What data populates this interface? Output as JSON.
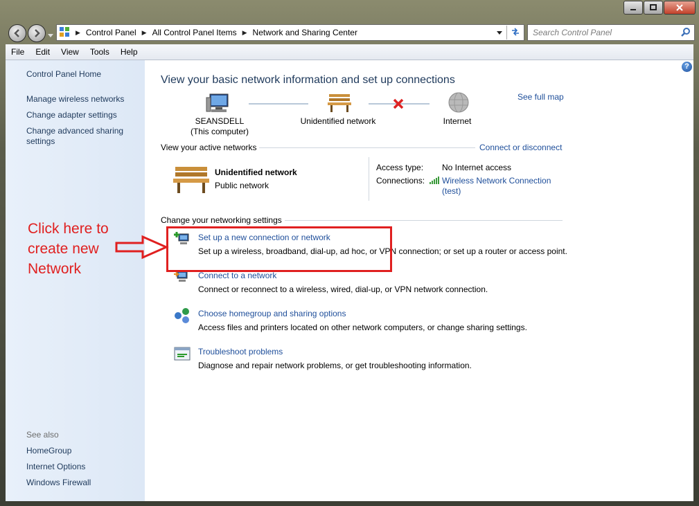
{
  "titlebar": {
    "minimize_icon": "minimize-icon",
    "maximize_icon": "maximize-icon",
    "close_icon": "close-icon"
  },
  "breadcrumb": {
    "items": [
      "Control Panel",
      "All Control Panel Items",
      "Network and Sharing Center"
    ]
  },
  "search": {
    "placeholder": "Search Control Panel"
  },
  "menu": {
    "items": [
      "File",
      "Edit",
      "View",
      "Tools",
      "Help"
    ]
  },
  "sidebar": {
    "home": "Control Panel Home",
    "links": [
      "Manage wireless networks",
      "Change adapter settings",
      "Change advanced sharing",
      "settings"
    ],
    "see_also_heading": "See also",
    "see_also": [
      "HomeGroup",
      "Internet Options",
      "Windows Firewall"
    ]
  },
  "main": {
    "heading": "View your basic network information and set up connections",
    "see_full_map": "See full map",
    "map": {
      "computer_name": "SEANSDELL",
      "computer_sub": "(This computer)",
      "network": "Unidentified network",
      "internet": "Internet"
    },
    "active_networks_label": "View your active networks",
    "connect_disconnect": "Connect or disconnect",
    "active": {
      "name": "Unidentified network",
      "type": "Public network",
      "access_type_label": "Access type:",
      "access_type_value": "No Internet access",
      "connections_label": "Connections:",
      "connection_link_1": "Wireless Network Connection",
      "connection_link_2": "(test)"
    },
    "change_settings_label": "Change your networking settings",
    "tasks": [
      {
        "title": "Set up a new connection or network",
        "desc": "Set up a wireless, broadband, dial-up, ad hoc, or VPN connection; or set up a router or access point."
      },
      {
        "title": "Connect to a network",
        "desc": "Connect or reconnect to a wireless, wired, dial-up, or VPN network connection."
      },
      {
        "title": "Choose homegroup and sharing options",
        "desc": "Access files and printers located on other network computers, or change sharing settings."
      },
      {
        "title": "Troubleshoot problems",
        "desc": "Diagnose and repair network problems, or get troubleshooting information."
      }
    ]
  },
  "annotation": {
    "lines": [
      "Click here to",
      "create new",
      "Network"
    ],
    "color": "#e02020"
  }
}
